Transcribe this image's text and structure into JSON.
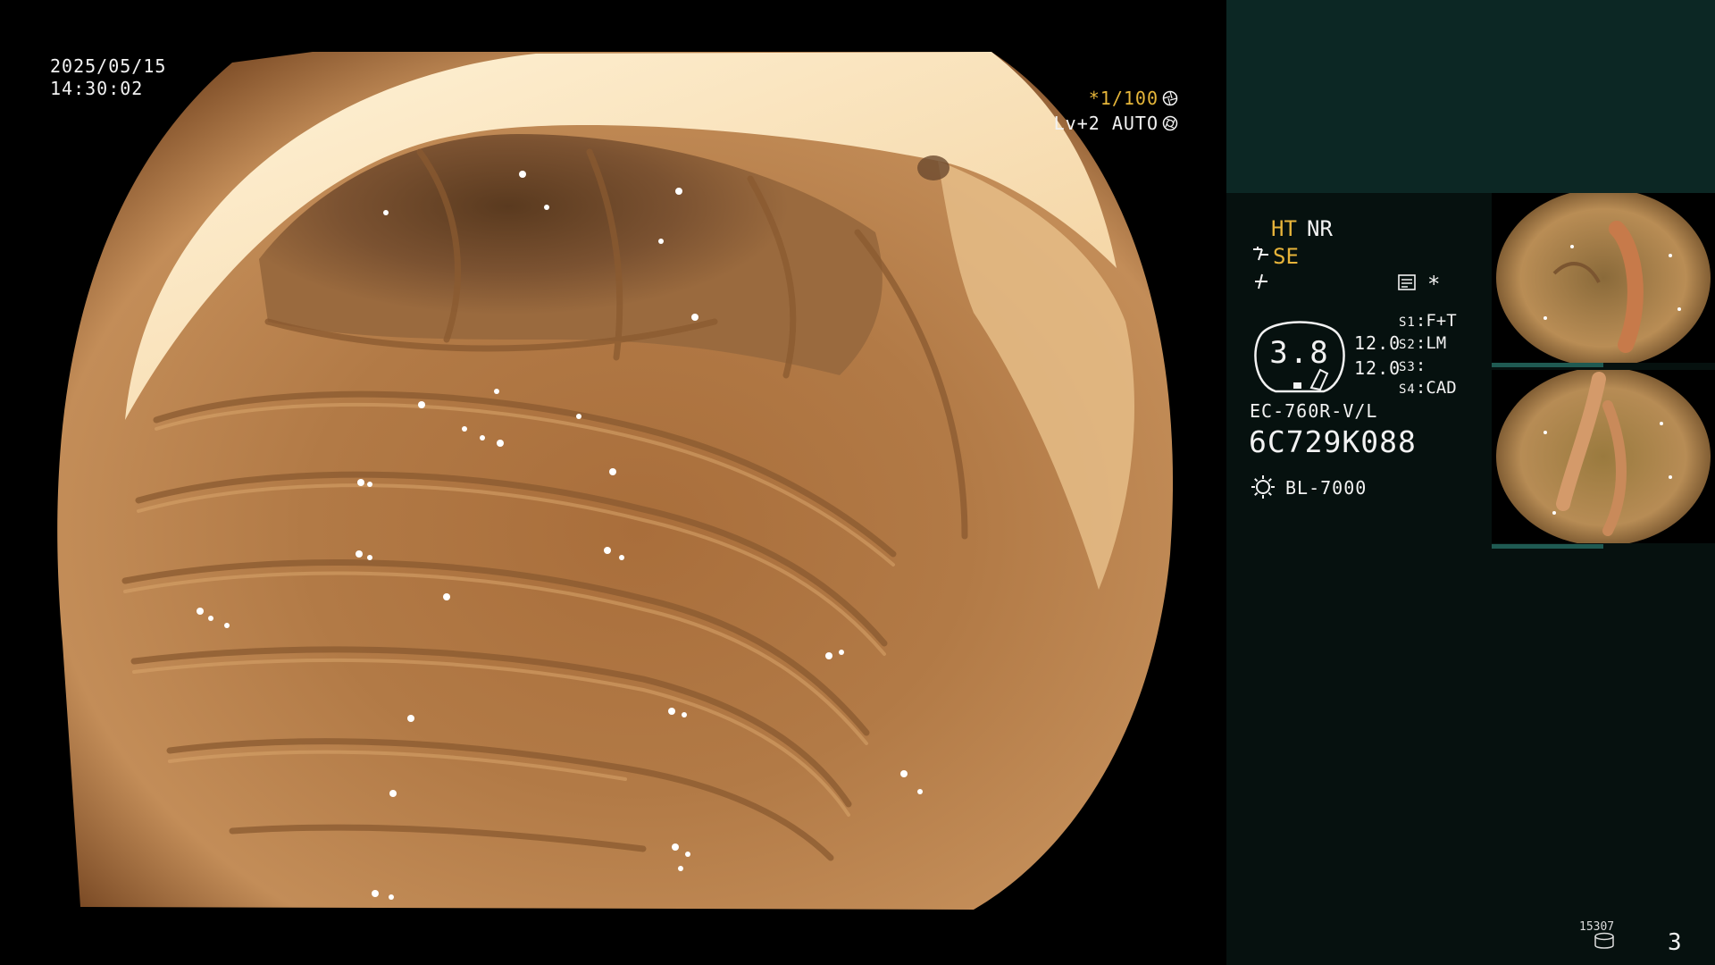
{
  "osd": {
    "date": "2025/05/15",
    "time": "14:30:02",
    "shutter": "*1/100",
    "level": "Lv+2 AUTO"
  },
  "panel": {
    "enhance": {
      "ht": "HT",
      "nr": "NR",
      "se": "SE",
      "star": "*"
    },
    "gauge_value": "3.8",
    "values": [
      "12.0",
      "12.0"
    ],
    "slots": [
      {
        "key": "S1",
        "value": "F+T"
      },
      {
        "key": "S2",
        "value": "LM"
      },
      {
        "key": "S3",
        "value": ""
      },
      {
        "key": "S4",
        "value": "CAD"
      }
    ],
    "scope_model": "EC-760R-V/L",
    "serial": "6C729K088",
    "light_source": "BL-7000",
    "storage": "15307",
    "page_count": "3"
  },
  "icons": {
    "shutter": "aperture-icon",
    "level": "iris-icon",
    "se": "structure-enhance-icon",
    "flash": "flash-icon",
    "screen": "screen-mode-icon",
    "light": "light-source-icon",
    "storage": "storage-icon"
  },
  "colors": {
    "panel_bg": "#06110f",
    "panel_top": "#0c2724",
    "highlight": "#e7b43a",
    "text": "#f2f2f2"
  }
}
